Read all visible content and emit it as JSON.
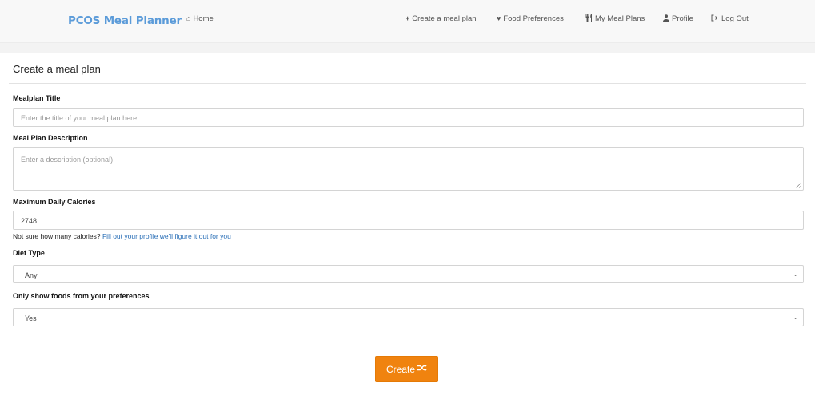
{
  "nav": {
    "brand": "PCOS Meal Planner",
    "home": "Home",
    "create": "Create a meal plan",
    "food_preferences": "Food Preferences",
    "my_meal_plans": "My Meal Plans",
    "profile": "Profile",
    "logout": "Log Out",
    "icons": {
      "home": "home-icon",
      "create": "plus-icon",
      "food_preferences": "heart-icon",
      "my_meal_plans": "cutlery-icon",
      "profile": "user-icon",
      "logout": "logout-icon"
    }
  },
  "page": {
    "title": "Create a meal plan"
  },
  "form": {
    "title_label": "Mealplan Title",
    "title_placeholder": "Enter the title of your meal plan here",
    "description_label": "Meal Plan Description",
    "description_placeholder": "Enter a description (optional)",
    "calories_label": "Maximum Daily Calories",
    "calories_value": "2748",
    "calories_help": "Not sure how many calories?",
    "calories_help_link": "Fill out your profile we'll figure it out for you",
    "diet_label": "Diet Type",
    "diet_value": "Any",
    "prefs_label": "Only show foods from your preferences",
    "prefs_value": "Yes",
    "submit_label": "Create",
    "submit_icon": "shuffle-icon"
  },
  "colors": {
    "brand": "#5b9bd9",
    "button": "#f0830f",
    "link": "#2a6fb7"
  }
}
